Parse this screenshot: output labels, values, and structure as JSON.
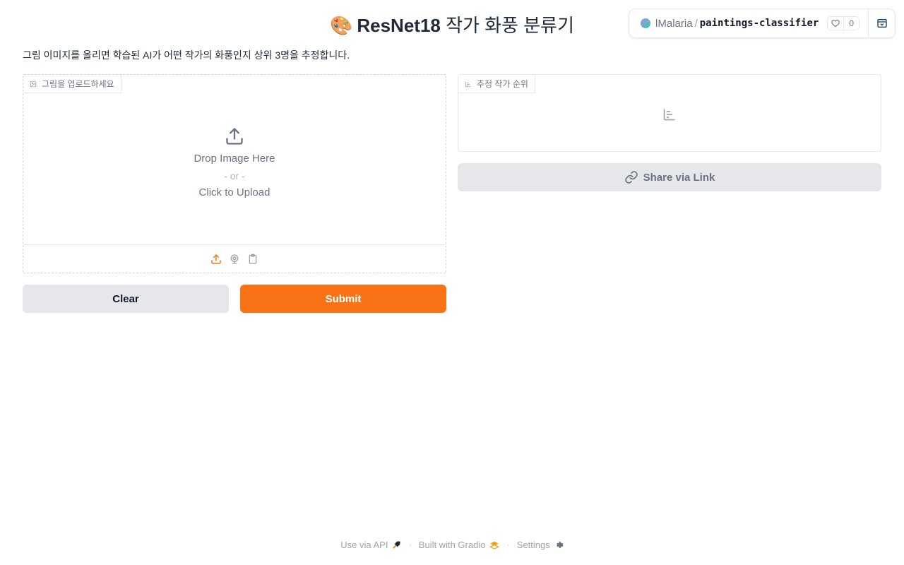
{
  "header": {
    "emoji": "🎨",
    "title_bold": "ResNet18",
    "title_rest": "작가 화풍 분류기"
  },
  "hf_badge": {
    "owner": "lMalaria",
    "separator": "/",
    "space_name": "paintings-classifier",
    "likes": "0"
  },
  "description": "그림 이미지를 올리면 학습된 AI가 어떤 작가의 화풍인지 상위 3명을 추정합니다.",
  "upload": {
    "label": "그림을 업로드하세요",
    "drop_text": "Drop Image Here",
    "or_text": "- or -",
    "click_text": "Click to Upload"
  },
  "result": {
    "label": "추정 작가 순위"
  },
  "buttons": {
    "clear": "Clear",
    "submit": "Submit",
    "share": "Share via Link"
  },
  "footer": {
    "api": "Use via API",
    "built": "Built with Gradio",
    "settings": "Settings",
    "separator": "·"
  },
  "colors": {
    "accent": "#f97316",
    "secondary_button": "#e5e7eb"
  }
}
